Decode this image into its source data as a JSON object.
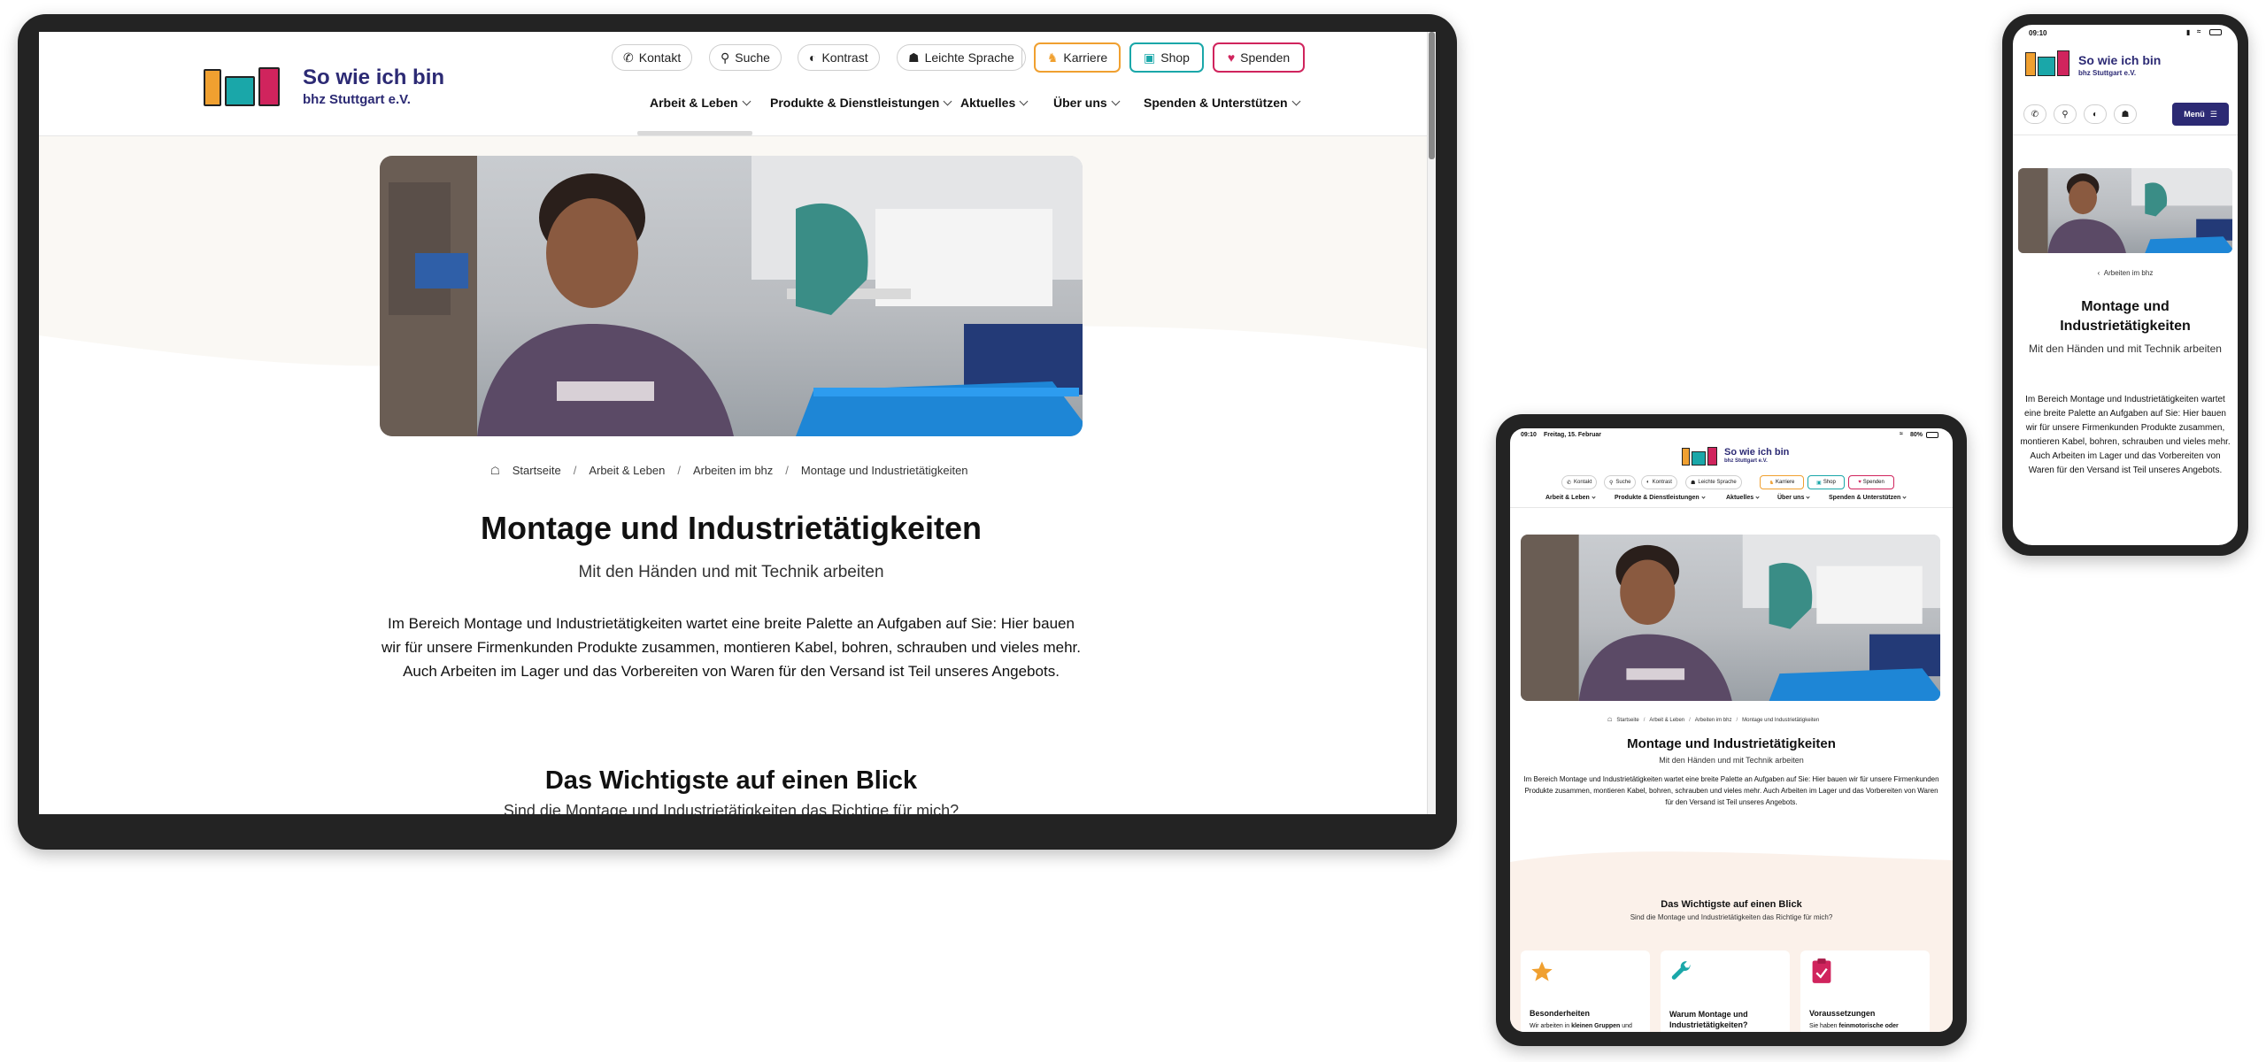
{
  "site": {
    "logo_title": "So wie ich bin",
    "logo_sub": "bhz Stuttgart e.V."
  },
  "utility_nav": [
    {
      "label": "Kontakt",
      "icon": "phone-icon"
    },
    {
      "label": "Suche",
      "icon": "search-icon"
    },
    {
      "label": "Kontrast",
      "icon": "contrast-icon"
    },
    {
      "label": "Leichte Sprache",
      "icon": "easy-language-icon"
    }
  ],
  "cta": [
    {
      "label": "Karriere",
      "icon": "people-icon",
      "color": "#f0a030"
    },
    {
      "label": "Shop",
      "icon": "bag-icon",
      "color": "#1aa7a9"
    },
    {
      "label": "Spenden",
      "icon": "heart-icon",
      "color": "#d0245d"
    }
  ],
  "main_nav": [
    {
      "label": "Arbeit & Leben",
      "active": true
    },
    {
      "label": "Produkte & Dienstleistungen",
      "active": false
    },
    {
      "label": "Aktuelles",
      "active": false
    },
    {
      "label": "Über uns",
      "active": false
    },
    {
      "label": "Spenden & Unterstützen",
      "active": false
    }
  ],
  "breadcrumb": [
    "Startseite",
    "Arbeit & Leben",
    "Arbeiten im bhz",
    "Montage und Industrietätigkeiten"
  ],
  "page": {
    "title": "Montage und Industrietätigkeiten",
    "subtitle": "Mit den Händen und mit Technik arbeiten",
    "intro": "Im Bereich Montage und Industrietätigkeiten wartet eine breite Palette an Aufgaben auf Sie: Hier bauen wir für unsere Firmenkunden Produkte zusammen, montieren Kabel, bohren, schrauben und vieles mehr. Auch Arbeiten im Lager und das Vorbereiten von Waren für den Versand ist Teil unseres Angebots.",
    "overview_title": "Das Wichtigste auf einen Blick",
    "overview_sub": "Sind die Montage und Industrietätigkeiten das Richtige für mich?"
  },
  "cards": [
    {
      "title": "Besonderheiten",
      "text_pre": "Wir arbeiten in ",
      "text_bold": "kleinen Gruppen",
      "text_post": " und",
      "icon": "star-icon",
      "color": "#f0a030"
    },
    {
      "title": "Warum Montage und Industrietätigkeiten?",
      "text_pre": "",
      "text_bold": "",
      "text_post": "",
      "icon": "wrench-icon",
      "color": "#1aa7a9"
    },
    {
      "title": "Voraussetzungen",
      "text_pre": "Sie haben ",
      "text_bold": "feinmotorische oder",
      "text_post": "",
      "icon": "clipboard-icon",
      "color": "#d0245d"
    }
  ],
  "tablet_status": {
    "time": "09:10",
    "date": "Freitag, 15. Februar",
    "battery": "80%"
  },
  "phone_status": {
    "time": "09:10"
  },
  "phone": {
    "menu_label": "Menü",
    "back_label": "Arbeiten im bhz",
    "title": "Montage und Industrietätigkeiten",
    "subtitle": "Mit den Händen und mit Technik arbeiten",
    "intro": "Im Bereich Montage und Industrietätigkeiten wartet eine breite Palette an Aufgaben auf Sie: Hier bauen wir für unsere Firmenkunden Produkte zusammen, montieren Kabel, bohren, schrauben und vieles mehr. Auch Arbeiten im Lager und das Vorbereiten von Waren für den Versand ist Teil unseres Angebots."
  },
  "colors": {
    "brand": "#2c2a74",
    "orange": "#f0a030",
    "teal": "#1aa7a9",
    "pink": "#d0245d",
    "cream": "#faf8f4",
    "peach": "#fbf1ea"
  }
}
